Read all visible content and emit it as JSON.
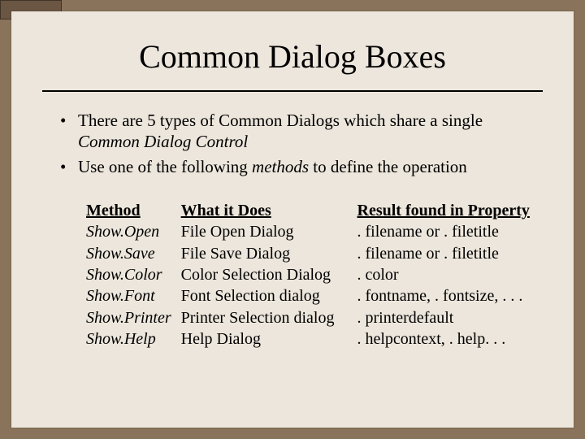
{
  "title": "Common Dialog Boxes",
  "bullets": [
    {
      "pre": "There are 5 types of Common Dialogs which share a single ",
      "em": "Common Dialog Control",
      "post": ""
    },
    {
      "pre": "Use one of the following ",
      "em": "methods",
      "post": " to define the operation"
    }
  ],
  "table": {
    "headers": {
      "method": "Method",
      "does": "What it Does",
      "result": "Result found in Property"
    },
    "rows": [
      {
        "method": "Show.Open",
        "does": "File Open Dialog",
        "result": ". filename or . filetitle"
      },
      {
        "method": "Show.Save",
        "does": "File Save Dialog",
        "result": ". filename or . filetitle"
      },
      {
        "method": "Show.Color",
        "does": "Color Selection Dialog",
        "result": ". color"
      },
      {
        "method": "Show.Font",
        "does": "Font Selection dialog",
        "result": ". fontname, . fontsize, . . ."
      },
      {
        "method": "Show.Printer",
        "does": "Printer Selection dialog",
        "result": ". printerdefault"
      },
      {
        "method": "Show.Help",
        "does": "Help Dialog",
        "result": ". helpcontext, . help. . ."
      }
    ]
  }
}
